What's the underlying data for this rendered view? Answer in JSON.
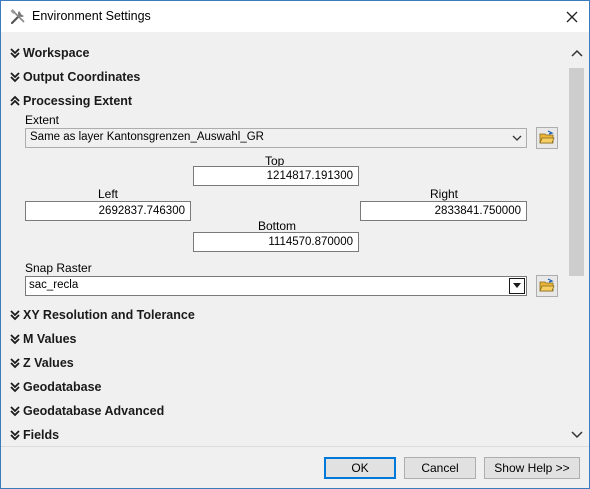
{
  "window": {
    "title": "Environment Settings"
  },
  "sections": [
    {
      "label": "Workspace",
      "expanded": false
    },
    {
      "label": "Output Coordinates",
      "expanded": false
    },
    {
      "label": "Processing Extent",
      "expanded": true
    },
    {
      "label": "XY Resolution and Tolerance",
      "expanded": false
    },
    {
      "label": "M Values",
      "expanded": false
    },
    {
      "label": "Z Values",
      "expanded": false
    },
    {
      "label": "Geodatabase",
      "expanded": false
    },
    {
      "label": "Geodatabase Advanced",
      "expanded": false
    },
    {
      "label": "Fields",
      "expanded": false
    }
  ],
  "extent": {
    "label": "Extent",
    "value": "Same as layer Kantonsgrenzen_Auswahl_GR",
    "top_label": "Top",
    "top": "1214817.191300",
    "left_label": "Left",
    "left": "2692837.746300",
    "right_label": "Right",
    "right": "2833841.750000",
    "bottom_label": "Bottom",
    "bottom": "1114570.870000"
  },
  "snap_raster": {
    "label": "Snap Raster",
    "value": "sac_recla"
  },
  "buttons": {
    "ok": "OK",
    "cancel": "Cancel",
    "show_help": "Show Help >>"
  },
  "colors": {
    "accent": "#0078d7",
    "window_border": "#3d7bbf",
    "folder": "#e8b53a"
  }
}
